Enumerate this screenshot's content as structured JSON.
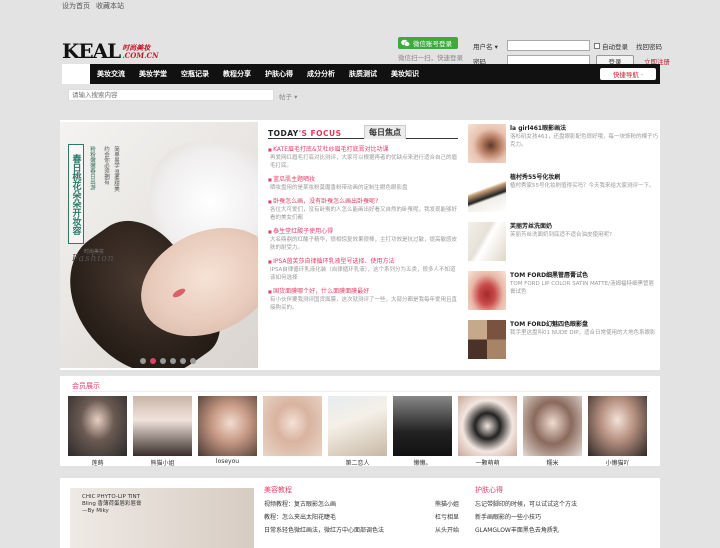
{
  "topbar": {
    "set_home": "设为首页",
    "bookmark": "收藏本站"
  },
  "logo": {
    "brand": "KEAL",
    "sub1": "时尚美妆",
    "sub2": ".COM.CN"
  },
  "wechat": {
    "button": "微信账号登录",
    "hint": "微信扫一扫，快速登录"
  },
  "login": {
    "user_label": "用户名",
    "user_dropdown": "▾",
    "pass_label": "密码",
    "remember": "自动登录",
    "forgot": "找回密码",
    "submit": "登录",
    "register": "立即注册"
  },
  "nav": {
    "items": [
      "美妆交流",
      "美妆学堂",
      "空瓶记录",
      "教程分享",
      "护肤心得",
      "成分分析",
      "肤质测试",
      "美妆知识"
    ],
    "quick": "快捷导航 ·"
  },
  "search": {
    "placeholder": "请输入搜索内容",
    "button": "帖子 ▾"
  },
  "banner": {
    "v1": "春日桃花朵朵开妆容",
    "v2": "粉粉嫩嫩春日出游",
    "v3": "约会你必须拥有",
    "v4": "简单易学 温柔甜美",
    "script": "Fashion",
    "mark": "时尚美妆"
  },
  "focus": {
    "en_a": "TODAY",
    "en_b": "'S FOCUS",
    "cn": "每日焦点",
    "items": [
      {
        "t": "KATE眉毛打底&艾杜纱眉毛打底膏对比功课",
        "d": "再爱网红眉毛打底对比测评，大家可以根据再者的优缺点来进行适合自己的眉毛打底。"
      },
      {
        "t": "蓝瓜肌主题晒妆",
        "d": "晒妆盘用的是某妆粉莫魔香粉带动画的定制生眼色眼影盘"
      },
      {
        "t": "卧蚕怎么画，没有卧蚕怎么画出卧蚕呢?",
        "d": "各位大可爱们，没有卧蚕的人怎么能画出好看又自然的卧蚕呢，我发现能够好看的美女们都"
      },
      {
        "t": "泰生堂红酸子使用心得",
        "d": "大名鼎鼎的红酸子精华，很相惊复效果很棒，主打功效是抗过敏，提高敏感皮肤的耐受力。"
      },
      {
        "t": "IPSA茵芙莎自律循环乳液型号选择、使用方法",
        "d": "IPSA自律循环乳液化装（自律循环乳液），这个系列分为五类，很多人不知道该如何选择"
      },
      {
        "t": "国货面膜哪个好，什么面膜面膜最好",
        "d": "有小伙伴要我测评国货面膜，这次就测评了一些，大部分都是我每年爱用且直接购买的。"
      }
    ]
  },
  "side": {
    "items": [
      {
        "t": "la girl461眼影画法",
        "d": "洛杉矶女孩461，还盘眼影配色很好哦，每一块饰粉的棵子巧克力。"
      },
      {
        "t": "植村秀55号化妆刷",
        "d": "植村秀家55号化妆刷值得买吗？今天我来给大家测评一下。"
      },
      {
        "t": "芙丽芳丝洗面奶",
        "d": "芙丽芳丝洗面奶到底适不适合油皮使用呢?"
      },
      {
        "t": "TOM FORD细黑管唇膏试色",
        "d": "TOM FORD LIP COLOR SATIN MATTE/汤姆福特细黑管唇膏试色"
      },
      {
        "t": "TOM FORD幻魅四色眼影盘",
        "d": "我手里这盘叫01 NUDE DIP，适合日常使用的大地色系眼影"
      }
    ]
  },
  "vip": {
    "title": "会员展示",
    "members": [
      "莲蒔",
      "熊猫小姐",
      "loseyou",
      "",
      "第二恋人",
      "懒懒。",
      "一颗萌萌",
      "糯米",
      "小懒猫吖",
      "笑给我听"
    ]
  },
  "bottom": {
    "pic_line1": "CHIC PHYTO-LIP TINT",
    "pic_line2": "Bling 香薄荷蛋唇彩唇膏",
    "pic_line3": "—By Miky",
    "col1": {
      "title": "美容教程",
      "items": [
        "视频教程：复古眼影怎么画",
        "教程：怎么夹出太阳花睫毛",
        "日常系轻色微红画法，微红方中心面部调色法"
      ]
    },
    "col2": {
      "items": [
        "熊猫小姐",
        "杠亏相显",
        "从头开始"
      ]
    },
    "col3": {
      "title": "护肤心得",
      "items": [
        "忘记带脚印的时候，可以试试这个方法",
        "新手画眼影的一些小技巧",
        "GLAMGLOW丰面黑色去角质乳"
      ]
    }
  },
  "colors": {
    "accent": "#e0406a",
    "nav_bg": "#111111",
    "wechat_green": "#3cab3c",
    "register_red": "#c0202a"
  }
}
